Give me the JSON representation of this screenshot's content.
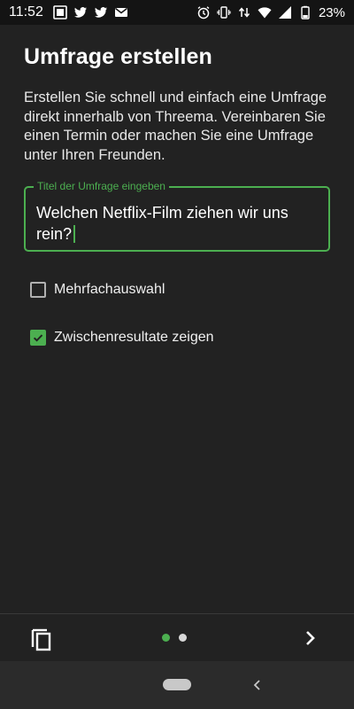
{
  "status_bar": {
    "time": "11:52",
    "battery_percent": "23%",
    "left_icons": [
      "threema-notification-icon",
      "twitter-icon",
      "twitter-icon",
      "gmail-icon"
    ],
    "right_icons": [
      "alarm-icon",
      "vibrate-icon",
      "data-arrows-icon",
      "wifi-icon",
      "signal-icon",
      "battery-icon"
    ]
  },
  "page": {
    "title": "Umfrage erstellen",
    "description": "Erstellen Sie schnell und einfach eine Umfrage direkt innerhalb von Threema. Vereinbaren Sie einen Termin oder machen Sie eine Umfrage unter Ihren Freunden."
  },
  "poll_title_field": {
    "label": "Titel der Umfrage eingeben",
    "value": "Welchen Netflix-Film ziehen wir uns rein?"
  },
  "options": [
    {
      "label": "Mehrfachauswahl",
      "checked": false
    },
    {
      "label": "Zwischenresultate zeigen",
      "checked": true
    }
  ],
  "toolbar": {
    "page_indicator": {
      "current": 1,
      "total": 2
    }
  },
  "colors": {
    "accent": "#4caf50",
    "background": "#222222",
    "status_bar": "#141414",
    "nav_bar": "#2b2b2b"
  }
}
